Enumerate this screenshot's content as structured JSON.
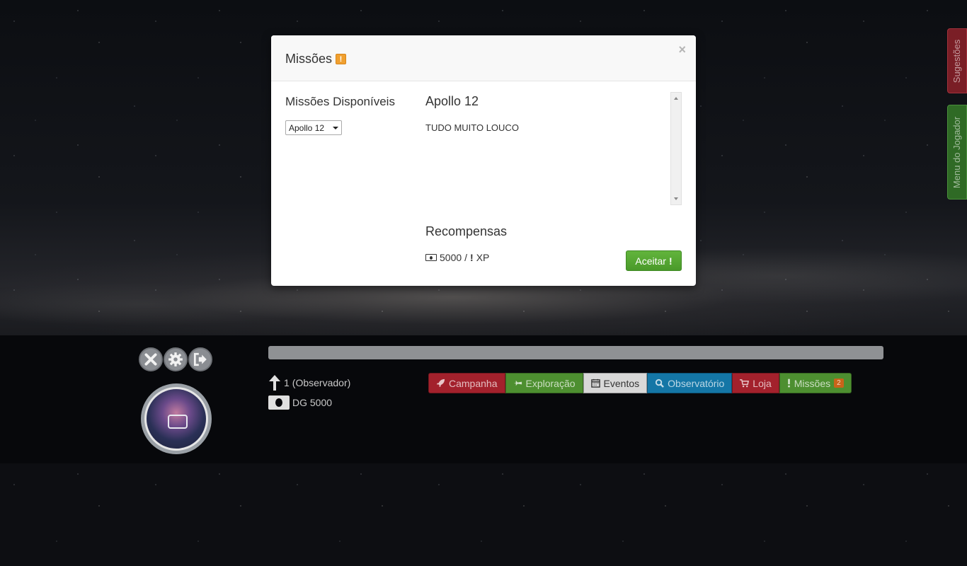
{
  "side_tabs": {
    "suggestions": "Sugestões",
    "player_menu": "Menu do Jogador"
  },
  "player": {
    "level_value": "1",
    "level_rank": "(Observador)",
    "money": "DG 5000",
    "xp_progress": 0
  },
  "nav": {
    "items": [
      {
        "label": "Campanha",
        "icon": "rocket-icon",
        "color": "#a3212c"
      },
      {
        "label": "Exploração",
        "icon": "plane-icon",
        "color": "#4d8f30"
      },
      {
        "label": "Eventos",
        "icon": "calendar-icon",
        "color": "#d8d8d8"
      },
      {
        "label": "Observatório",
        "icon": "search-icon",
        "color": "#1476a6"
      },
      {
        "label": "Loja",
        "icon": "cart-icon",
        "color": "#a3212c"
      },
      {
        "label": "Missões",
        "icon": "exclamation-icon",
        "color": "#4d8f30",
        "badge": "2"
      }
    ]
  },
  "modal": {
    "title": "Missões",
    "title_badge": "!",
    "close": "×",
    "available_title": "Missões Disponíveis",
    "selected_mission": "Apollo 12",
    "mission_name": "Apollo 12",
    "mission_description": "TUDO MUITO LOUCO",
    "rewards_title": "Recompensas",
    "reward_money": "5000",
    "reward_separator": "/",
    "reward_xp_mark": "!",
    "reward_xp": "XP",
    "accept_label": "Aceitar",
    "accept_mark": "!"
  }
}
